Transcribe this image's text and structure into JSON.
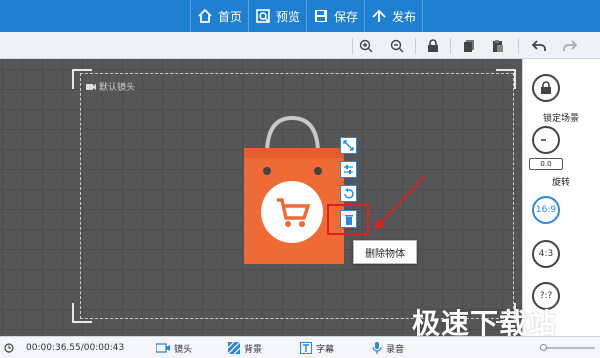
{
  "menu": {
    "home": "首页",
    "preview": "预览",
    "save": "保存",
    "publish": "发布"
  },
  "toolbar": {
    "icons": [
      "zoom-in-icon",
      "zoom-out-icon",
      "lock-icon",
      "copy-icon",
      "paste-icon",
      "undo-icon",
      "redo-icon"
    ]
  },
  "stage": {
    "camera_label": "默认镜头"
  },
  "object_tools": {
    "tooltip": "删除物体"
  },
  "right_panel": {
    "lock_scene": "锁定场景",
    "rotate_value": "0.0",
    "rotate": "旋转",
    "ratio_16_9": "16:9",
    "ratio_4_3": "4:3",
    "ratio_custom": "?:?"
  },
  "bottom": {
    "time": "00:00:36.55/00:00:43",
    "camera": "镜头",
    "background": "背景",
    "subtitle": "字幕",
    "record": "录音"
  },
  "watermark": "极速下载站",
  "colors": {
    "accent": "#1f7fd1",
    "bag": "#f06a35",
    "highlight": "#e02020"
  }
}
